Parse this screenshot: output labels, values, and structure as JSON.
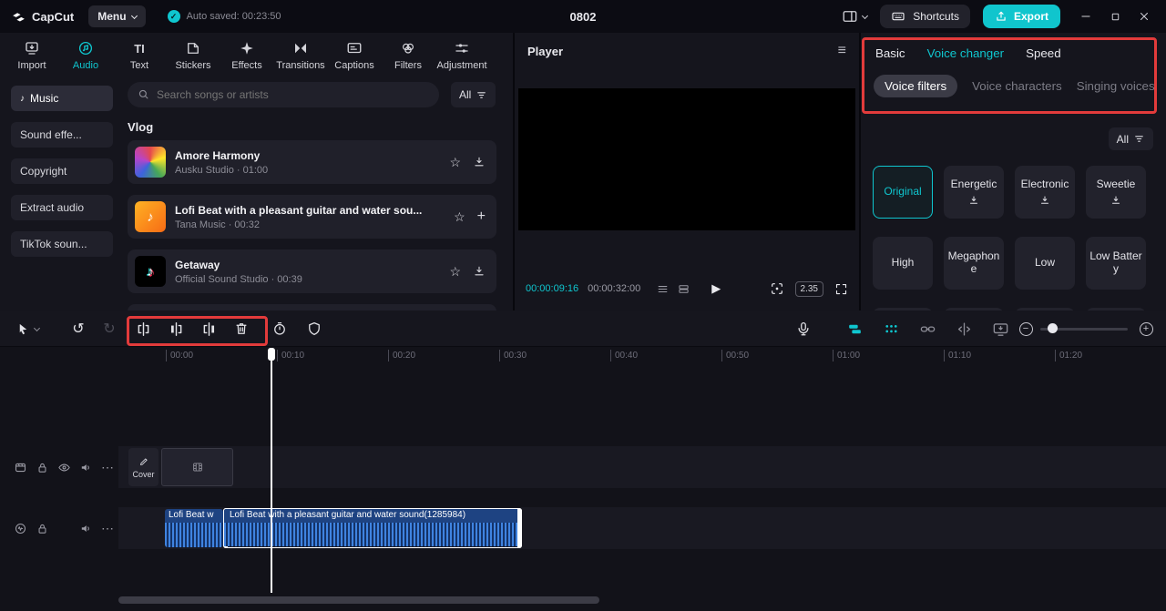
{
  "colors": {
    "accent": "#0fc6cf",
    "highlight": "#e23b3b",
    "clip_blue": "#2f6ad6"
  },
  "icons": {
    "star": "☆",
    "plus": "+",
    "play": "▶",
    "hamburger": "≡",
    "ellipsis": "⋯",
    "note": "♪",
    "check": "✓",
    "undo": "↺",
    "redo": "↻",
    "minus": "−",
    "text_tab": "TI"
  },
  "titlebar": {
    "logo_text": "CapCut",
    "menu_label": "Menu",
    "autosave_text": "Auto saved: 00:23:50",
    "project_title": "0802",
    "shortcuts_label": "Shortcuts",
    "export_label": "Export"
  },
  "media_panel": {
    "tabs": [
      "Import",
      "Audio",
      "Text",
      "Stickers",
      "Effects",
      "Transitions",
      "Captions",
      "Filters",
      "Adjustment"
    ],
    "sidebar_items": [
      "Music",
      "Sound effe...",
      "Copyright",
      "Extract audio",
      "TikTok soun..."
    ],
    "search_placeholder": "Search songs or artists",
    "filter_label": "All",
    "section_title": "Vlog",
    "songs": [
      {
        "title": "Amore Harmony",
        "meta": "Ausku Studio · 01:00"
      },
      {
        "title": "Lofi Beat with a pleasant guitar and water sou...",
        "meta": "Tana Music · 00:32"
      },
      {
        "title": "Getaway",
        "meta": "Official Sound Studio · 00:39"
      }
    ]
  },
  "player": {
    "title": "Player",
    "current_time": "00:00:09:16",
    "total_time": "00:00:32:00",
    "ratio_label": "2.35"
  },
  "voice_panel": {
    "tabs": [
      "Basic",
      "Voice changer",
      "Speed"
    ],
    "subtabs": [
      "Voice filters",
      "Voice characters",
      "Singing voices"
    ],
    "filter_label": "All",
    "voices": [
      "Original",
      "Energetic",
      "Electronic",
      "Sweetie",
      "High",
      "Megaphone",
      "Low",
      "Low Battery"
    ]
  },
  "timeline": {
    "ruler": [
      "00:00",
      "00:10",
      "00:20",
      "00:30",
      "00:40",
      "00:50",
      "01:00",
      "01:10",
      "01:20"
    ],
    "cover_label": "Cover",
    "audio_clip_left": "Lofi Beat w",
    "audio_clip_main": "Lofi Beat with a pleasant guitar and water sound(1285984)"
  }
}
